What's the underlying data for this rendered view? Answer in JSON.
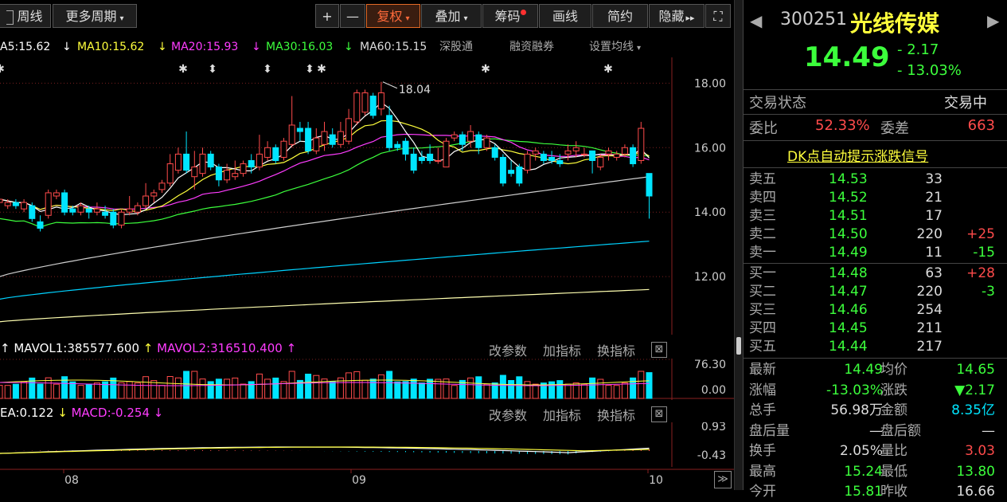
{
  "toolbar": {
    "left_items": [
      {
        "label": "周线",
        "icon": "box-icon"
      },
      {
        "label": "更多周期",
        "caret": "▾"
      }
    ],
    "plus": "+",
    "minus": "—",
    "fuquan": "复权",
    "fuquan_caret": "▾",
    "diejia": "叠加",
    "diejia_caret": "▾",
    "chouma": "筹码",
    "huaxian": "画线",
    "jianyue": "简约",
    "yincang": "隐藏",
    "yincang_arrow": "▸▸",
    "fullscreen": "⛶"
  },
  "ma_legend": {
    "ma5": "A5:15.62",
    "ma10": "MA10:15.62",
    "ma20": "MA20:15.93",
    "ma30": "MA30:16.03",
    "ma60": "MA60:15.15",
    "links": [
      "深股通",
      "融资融券",
      "设置均线"
    ],
    "caret": "▾",
    "arrow_down": "↓"
  },
  "chart_data": [
    {
      "type": "candlestick",
      "name": "price",
      "y_ticks": [
        "18.00",
        "16.00",
        "14.00",
        "12.00"
      ],
      "ylim": [
        10.2,
        18.8
      ],
      "annotation": "18.04",
      "x_labels": [
        "08",
        "09",
        "10"
      ],
      "candles": [
        [
          14.3,
          14.4,
          14.1,
          14.5
        ],
        [
          14.2,
          14.3,
          14.1,
          14.4
        ],
        [
          14.3,
          14.2,
          14.1,
          14.4
        ],
        [
          14.1,
          14.3,
          14.0,
          14.4
        ],
        [
          14.2,
          13.8,
          13.7,
          14.3
        ],
        [
          13.7,
          13.5,
          13.4,
          13.9
        ],
        [
          13.9,
          14.6,
          13.8,
          14.7
        ],
        [
          14.5,
          14.6,
          14.4,
          14.7
        ],
        [
          14.6,
          14.0,
          13.9,
          14.7
        ],
        [
          14.1,
          14.0,
          13.9,
          14.2
        ],
        [
          14.0,
          14.2,
          13.9,
          14.3
        ],
        [
          14.1,
          14.0,
          13.8,
          14.2
        ],
        [
          14.0,
          14.1,
          13.9,
          14.3
        ],
        [
          14.0,
          13.9,
          13.8,
          14.2
        ],
        [
          14.0,
          13.6,
          13.5,
          14.1
        ],
        [
          13.6,
          14.0,
          13.5,
          14.1
        ],
        [
          14.0,
          14.1,
          13.9,
          14.5
        ],
        [
          14.0,
          14.2,
          13.9,
          14.3
        ],
        [
          14.2,
          14.5,
          14.1,
          14.9
        ],
        [
          14.5,
          14.6,
          14.3,
          14.7
        ],
        [
          14.7,
          14.9,
          14.6,
          15.0
        ],
        [
          14.9,
          15.5,
          14.8,
          15.8
        ],
        [
          15.3,
          15.8,
          15.2,
          16.0
        ],
        [
          15.8,
          15.3,
          15.2,
          16.5
        ],
        [
          15.1,
          15.4,
          14.7,
          15.9
        ],
        [
          15.2,
          15.8,
          15.1,
          16.0
        ],
        [
          15.8,
          15.4,
          15.3,
          15.9
        ],
        [
          15.4,
          15.0,
          14.8,
          15.5
        ],
        [
          15.0,
          15.3,
          14.9,
          15.5
        ],
        [
          15.1,
          15.2,
          15.0,
          15.6
        ],
        [
          15.2,
          15.5,
          15.1,
          15.6
        ],
        [
          15.6,
          15.4,
          15.2,
          15.8
        ],
        [
          15.4,
          15.8,
          15.3,
          16.4
        ],
        [
          15.7,
          16.0,
          15.6,
          16.2
        ],
        [
          16.0,
          15.6,
          15.5,
          16.1
        ],
        [
          15.7,
          16.2,
          15.6,
          16.3
        ],
        [
          16.1,
          16.7,
          16.0,
          17.6
        ],
        [
          16.6,
          16.5,
          16.2,
          16.8
        ],
        [
          16.6,
          15.9,
          15.8,
          16.8
        ],
        [
          15.9,
          16.3,
          15.8,
          16.6
        ],
        [
          16.1,
          16.5,
          15.9,
          16.8
        ],
        [
          16.4,
          16.1,
          16.0,
          16.6
        ],
        [
          16.1,
          16.5,
          16.0,
          16.8
        ],
        [
          16.2,
          16.9,
          16.1,
          17.2
        ],
        [
          16.8,
          17.7,
          16.7,
          17.8
        ],
        [
          17.1,
          17.7,
          17.0,
          17.8
        ],
        [
          17.6,
          17.0,
          16.9,
          17.7
        ],
        [
          17.2,
          17.7,
          17.0,
          18.04
        ],
        [
          17.0,
          16.0,
          15.9,
          17.3
        ],
        [
          16.1,
          16.0,
          15.9,
          16.2
        ],
        [
          16.2,
          15.8,
          15.6,
          16.3
        ],
        [
          15.8,
          15.3,
          15.2,
          16.0
        ],
        [
          15.7,
          15.6,
          15.5,
          15.9
        ],
        [
          15.8,
          15.6,
          15.5,
          16.1
        ],
        [
          15.6,
          15.6,
          15.5,
          16.0
        ],
        [
          15.4,
          16.2,
          15.4,
          16.3
        ],
        [
          16.3,
          16.4,
          16.2,
          16.5
        ],
        [
          16.4,
          16.1,
          15.9,
          16.5
        ],
        [
          16.2,
          16.5,
          16.0,
          16.7
        ],
        [
          16.4,
          16.0,
          15.8,
          16.5
        ],
        [
          16.0,
          16.3,
          15.9,
          16.4
        ],
        [
          16.0,
          15.7,
          15.6,
          16.1
        ],
        [
          15.7,
          14.9,
          14.8,
          15.8
        ],
        [
          15.3,
          15.2,
          15.1,
          15.6
        ],
        [
          15.4,
          14.9,
          14.8,
          15.5
        ],
        [
          15.3,
          15.8,
          15.2,
          15.9
        ],
        [
          15.8,
          15.9,
          15.6,
          16.0
        ],
        [
          15.8,
          15.6,
          15.5,
          15.9
        ],
        [
          15.7,
          15.6,
          15.5,
          15.9
        ],
        [
          15.6,
          15.5,
          15.4,
          15.8
        ],
        [
          15.8,
          15.9,
          15.6,
          16.1
        ],
        [
          15.9,
          16.0,
          15.7,
          16.2
        ],
        [
          15.8,
          15.8,
          15.7,
          16.0
        ],
        [
          15.9,
          15.6,
          15.2,
          15.9
        ],
        [
          15.4,
          15.7,
          15.3,
          15.8
        ],
        [
          15.8,
          15.9,
          15.6,
          16.0
        ],
        [
          15.7,
          15.8,
          15.6,
          15.9
        ],
        [
          15.8,
          16.0,
          15.7,
          16.1
        ],
        [
          16.0,
          15.5,
          15.4,
          16.1
        ],
        [
          15.6,
          16.6,
          15.5,
          16.8
        ],
        [
          15.2,
          14.5,
          13.8,
          15.2
        ]
      ]
    },
    {
      "type": "bar",
      "name": "volume",
      "legend": [
        "MAVOL1:385577.600",
        "MAVOL2:316510.400"
      ],
      "y_ticks": [
        "76.30",
        "0.00"
      ]
    },
    {
      "type": "macd",
      "name": "macd",
      "legend": [
        "EA:0.122",
        "MACD:-0.254"
      ],
      "y_ticks": [
        "0.93",
        "-0.43"
      ]
    }
  ],
  "panel_actions": [
    "改参数",
    "加指标",
    "换指标"
  ],
  "close_glyph": "⊠",
  "quote": {
    "code": "300251",
    "name": "光线传媒",
    "price": "14.49",
    "change": "- 2.17",
    "pct": "- 13.03%",
    "nav_left": "◀",
    "nav_right": "▶",
    "status_label": "交易状态",
    "status_value": "交易中",
    "weibi_label": "委比",
    "weibi_value": "52.33%",
    "weicha_label": "委差",
    "weicha_value": "663",
    "signal_link": "DK点自动提示涨跌信号",
    "asks": [
      {
        "label": "卖五",
        "price": "14.53",
        "vol": "33",
        "chg": ""
      },
      {
        "label": "卖四",
        "price": "14.52",
        "vol": "21",
        "chg": ""
      },
      {
        "label": "卖三",
        "price": "14.51",
        "vol": "17",
        "chg": ""
      },
      {
        "label": "卖二",
        "price": "14.50",
        "vol": "220",
        "chg": "+25"
      },
      {
        "label": "卖一",
        "price": "14.49",
        "vol": "11",
        "chg": "-15"
      }
    ],
    "bids": [
      {
        "label": "买一",
        "price": "14.48",
        "vol": "63",
        "chg": "+28"
      },
      {
        "label": "买二",
        "price": "14.47",
        "vol": "220",
        "chg": "-3"
      },
      {
        "label": "买三",
        "price": "14.46",
        "vol": "254",
        "chg": ""
      },
      {
        "label": "买四",
        "price": "14.45",
        "vol": "211",
        "chg": ""
      },
      {
        "label": "买五",
        "price": "14.44",
        "vol": "217",
        "chg": ""
      }
    ],
    "stats": [
      {
        "l1": "最新",
        "v1": "14.49",
        "l2": "均价",
        "v2": "14.65"
      },
      {
        "l1": "涨幅",
        "v1": "-13.03%",
        "l2": "涨跌",
        "v2": "▼2.17"
      },
      {
        "l1": "总手",
        "v1": "56.98万",
        "l2": "金额",
        "v2": "8.35亿"
      },
      {
        "l1": "盘后量",
        "v1": "—",
        "l2": "盘后额",
        "v2": "—"
      },
      {
        "l1": "换手",
        "v1": "2.05%",
        "l2": "量比",
        "v2": "3.03"
      },
      {
        "l1": "最高",
        "v1": "15.24",
        "l2": "最低",
        "v2": "13.80"
      },
      {
        "l1": "今开",
        "v1": "15.81",
        "l2": "昨收",
        "v2": "16.66"
      }
    ]
  },
  "colors": {
    "up": "#ff4b4b",
    "down": "#00e5ff",
    "green": "#3cff3c",
    "yellow": "#ffff3c",
    "magenta": "#ff3cff",
    "white": "#ffffff",
    "grid": "#7a1f1f"
  }
}
